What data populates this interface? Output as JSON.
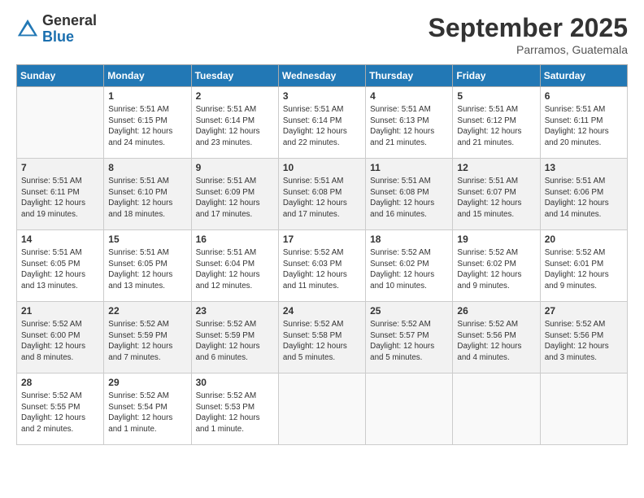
{
  "logo": {
    "general": "General",
    "blue": "Blue"
  },
  "title": "September 2025",
  "subtitle": "Parramos, Guatemala",
  "days_of_week": [
    "Sunday",
    "Monday",
    "Tuesday",
    "Wednesday",
    "Thursday",
    "Friday",
    "Saturday"
  ],
  "weeks": [
    {
      "bg": "white",
      "days": [
        {
          "num": "",
          "info": ""
        },
        {
          "num": "1",
          "info": "Sunrise: 5:51 AM\nSunset: 6:15 PM\nDaylight: 12 hours\nand 24 minutes."
        },
        {
          "num": "2",
          "info": "Sunrise: 5:51 AM\nSunset: 6:14 PM\nDaylight: 12 hours\nand 23 minutes."
        },
        {
          "num": "3",
          "info": "Sunrise: 5:51 AM\nSunset: 6:14 PM\nDaylight: 12 hours\nand 22 minutes."
        },
        {
          "num": "4",
          "info": "Sunrise: 5:51 AM\nSunset: 6:13 PM\nDaylight: 12 hours\nand 21 minutes."
        },
        {
          "num": "5",
          "info": "Sunrise: 5:51 AM\nSunset: 6:12 PM\nDaylight: 12 hours\nand 21 minutes."
        },
        {
          "num": "6",
          "info": "Sunrise: 5:51 AM\nSunset: 6:11 PM\nDaylight: 12 hours\nand 20 minutes."
        }
      ]
    },
    {
      "bg": "gray",
      "days": [
        {
          "num": "7",
          "info": "Sunrise: 5:51 AM\nSunset: 6:11 PM\nDaylight: 12 hours\nand 19 minutes."
        },
        {
          "num": "8",
          "info": "Sunrise: 5:51 AM\nSunset: 6:10 PM\nDaylight: 12 hours\nand 18 minutes."
        },
        {
          "num": "9",
          "info": "Sunrise: 5:51 AM\nSunset: 6:09 PM\nDaylight: 12 hours\nand 17 minutes."
        },
        {
          "num": "10",
          "info": "Sunrise: 5:51 AM\nSunset: 6:08 PM\nDaylight: 12 hours\nand 17 minutes."
        },
        {
          "num": "11",
          "info": "Sunrise: 5:51 AM\nSunset: 6:08 PM\nDaylight: 12 hours\nand 16 minutes."
        },
        {
          "num": "12",
          "info": "Sunrise: 5:51 AM\nSunset: 6:07 PM\nDaylight: 12 hours\nand 15 minutes."
        },
        {
          "num": "13",
          "info": "Sunrise: 5:51 AM\nSunset: 6:06 PM\nDaylight: 12 hours\nand 14 minutes."
        }
      ]
    },
    {
      "bg": "white",
      "days": [
        {
          "num": "14",
          "info": "Sunrise: 5:51 AM\nSunset: 6:05 PM\nDaylight: 12 hours\nand 13 minutes."
        },
        {
          "num": "15",
          "info": "Sunrise: 5:51 AM\nSunset: 6:05 PM\nDaylight: 12 hours\nand 13 minutes."
        },
        {
          "num": "16",
          "info": "Sunrise: 5:51 AM\nSunset: 6:04 PM\nDaylight: 12 hours\nand 12 minutes."
        },
        {
          "num": "17",
          "info": "Sunrise: 5:52 AM\nSunset: 6:03 PM\nDaylight: 12 hours\nand 11 minutes."
        },
        {
          "num": "18",
          "info": "Sunrise: 5:52 AM\nSunset: 6:02 PM\nDaylight: 12 hours\nand 10 minutes."
        },
        {
          "num": "19",
          "info": "Sunrise: 5:52 AM\nSunset: 6:02 PM\nDaylight: 12 hours\nand 9 minutes."
        },
        {
          "num": "20",
          "info": "Sunrise: 5:52 AM\nSunset: 6:01 PM\nDaylight: 12 hours\nand 9 minutes."
        }
      ]
    },
    {
      "bg": "gray",
      "days": [
        {
          "num": "21",
          "info": "Sunrise: 5:52 AM\nSunset: 6:00 PM\nDaylight: 12 hours\nand 8 minutes."
        },
        {
          "num": "22",
          "info": "Sunrise: 5:52 AM\nSunset: 5:59 PM\nDaylight: 12 hours\nand 7 minutes."
        },
        {
          "num": "23",
          "info": "Sunrise: 5:52 AM\nSunset: 5:59 PM\nDaylight: 12 hours\nand 6 minutes."
        },
        {
          "num": "24",
          "info": "Sunrise: 5:52 AM\nSunset: 5:58 PM\nDaylight: 12 hours\nand 5 minutes."
        },
        {
          "num": "25",
          "info": "Sunrise: 5:52 AM\nSunset: 5:57 PM\nDaylight: 12 hours\nand 5 minutes."
        },
        {
          "num": "26",
          "info": "Sunrise: 5:52 AM\nSunset: 5:56 PM\nDaylight: 12 hours\nand 4 minutes."
        },
        {
          "num": "27",
          "info": "Sunrise: 5:52 AM\nSunset: 5:56 PM\nDaylight: 12 hours\nand 3 minutes."
        }
      ]
    },
    {
      "bg": "white",
      "days": [
        {
          "num": "28",
          "info": "Sunrise: 5:52 AM\nSunset: 5:55 PM\nDaylight: 12 hours\nand 2 minutes."
        },
        {
          "num": "29",
          "info": "Sunrise: 5:52 AM\nSunset: 5:54 PM\nDaylight: 12 hours\nand 1 minute."
        },
        {
          "num": "30",
          "info": "Sunrise: 5:52 AM\nSunset: 5:53 PM\nDaylight: 12 hours\nand 1 minute."
        },
        {
          "num": "",
          "info": ""
        },
        {
          "num": "",
          "info": ""
        },
        {
          "num": "",
          "info": ""
        },
        {
          "num": "",
          "info": ""
        }
      ]
    }
  ]
}
